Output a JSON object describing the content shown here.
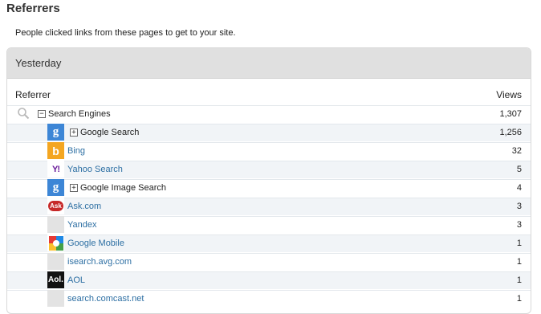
{
  "page": {
    "title": "Referrers",
    "description": "People clicked links from these pages to get to your site."
  },
  "panel": {
    "period": "Yesterday",
    "columns": {
      "referrer": "Referrer",
      "views": "Views"
    }
  },
  "rows": [
    {
      "label": "Search Engines",
      "views": "1,307",
      "icon": "search-icon",
      "toggle": "−",
      "is_link": false
    },
    {
      "label": "Google Search",
      "views": "1,256",
      "icon": "google-icon",
      "toggle": "+",
      "is_link": false
    },
    {
      "label": "Bing",
      "views": "32",
      "icon": "bing-icon",
      "toggle": "",
      "is_link": true
    },
    {
      "label": "Yahoo Search",
      "views": "5",
      "icon": "yahoo-icon",
      "toggle": "",
      "is_link": true
    },
    {
      "label": "Google Image Search",
      "views": "4",
      "icon": "google-icon",
      "toggle": "+",
      "is_link": false
    },
    {
      "label": "Ask.com",
      "views": "3",
      "icon": "ask-icon",
      "toggle": "",
      "is_link": true
    },
    {
      "label": "Yandex",
      "views": "3",
      "icon": "blank-icon",
      "toggle": "",
      "is_link": true
    },
    {
      "label": "Google Mobile",
      "views": "1",
      "icon": "google-mobile-icon",
      "toggle": "",
      "is_link": true
    },
    {
      "label": "isearch.avg.com",
      "views": "1",
      "icon": "blank-icon",
      "toggle": "",
      "is_link": true
    },
    {
      "label": "AOL",
      "views": "1",
      "icon": "aol-icon",
      "toggle": "",
      "is_link": true
    },
    {
      "label": "search.comcast.net",
      "views": "1",
      "icon": "blank-icon",
      "toggle": "",
      "is_link": true
    }
  ],
  "icon_glyphs": {
    "google": "g",
    "bing": "b",
    "yahoo": "Y!",
    "ask": "Ask",
    "aol": "Aol."
  },
  "colors": {
    "link": "#2d6fa3",
    "header_bg": "#e0e0e0",
    "row_shade": "#f1f4f7"
  }
}
